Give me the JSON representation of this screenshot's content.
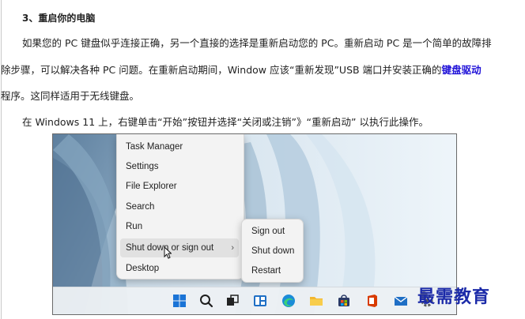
{
  "article": {
    "heading": "3、重启你的电脑",
    "p1_line1": "如果您的 PC 键盘似乎连接正确，另一个直接的选择是重新启动您的 PC。重新启动 PC 是一个简单的故障排",
    "p1_line2_before": "除步骤，可以解决各种 PC 问题。在重新启动期间，Window 应该“重新发现”USB 端口并安装正确的",
    "p1_link": "键盘驱动",
    "p1_line3": "程序。这同样适用于无线键盘。",
    "p2": "在 Windows 11 上，右键单击“开始”按钮并选择“关闭或注销”》“重新启动” 以执行此操作。"
  },
  "screenshot": {
    "context_menu": {
      "items": [
        "Task Manager",
        "Settings",
        "File Explorer",
        "Search",
        "Run",
        "Shut down or sign out",
        "Desktop"
      ],
      "chevron": "›"
    },
    "submenu": {
      "items": [
        "Sign out",
        "Shut down",
        "Restart"
      ]
    },
    "taskbar": {
      "icons": [
        "windows-start-icon",
        "search-icon",
        "task-view-icon",
        "widgets-icon",
        "edge-icon",
        "file-explorer-icon",
        "store-icon",
        "office-icon",
        "mail-icon",
        "settings-icon"
      ]
    }
  },
  "watermark": "最需教育",
  "colors": {
    "link": "#1e10d8",
    "watermark": "#1b2aa8",
    "text": "#222222"
  }
}
